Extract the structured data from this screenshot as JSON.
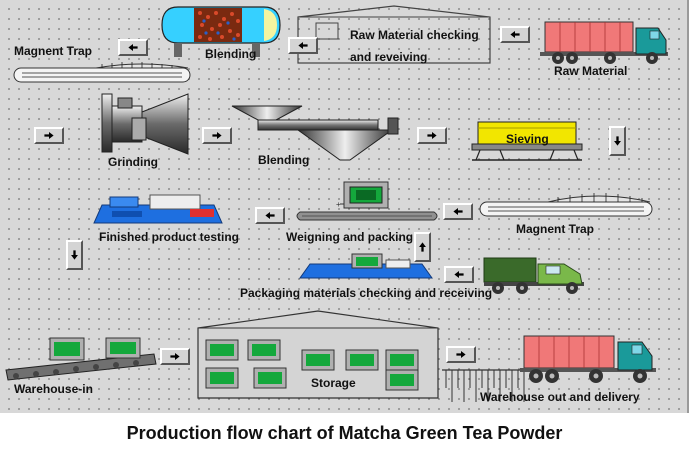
{
  "title": "Production flow chart of Matcha Green Tea Powder",
  "steps": {
    "raw_material": "Raw Material",
    "raw_checking": "Raw Material checking and reveiving",
    "raw_checking_line1": "Raw Material checking",
    "raw_checking_line2": "and reveiving",
    "magnet_trap_top": "Magnent Trap",
    "blending_top": "Blending",
    "grinding": "Grinding",
    "blending_mid": "Blending",
    "sieving": "Sieving",
    "magnet_trap_mid": "Magnent Trap",
    "weighing": "Weigning and packing",
    "finished_testing": "Finished product testing",
    "packaging_checking": "Packaging materials checking and receiving",
    "warehouse_in": "Warehouse-in",
    "storage": "Storage",
    "warehouse_out": "Warehouse out and delivery"
  },
  "colors": {
    "background": "#d8d8d8",
    "truck_cargo": "#f07878",
    "truck_cab": "#1a9a9a",
    "green_truck": "#3a6a2a",
    "sieving_yellow": "#f2e600",
    "testing_blue": "#1e6fe0",
    "screen_green": "#14a83c"
  },
  "icons": [
    "left-arrow-icon",
    "right-arrow-icon",
    "down-arrow-icon",
    "up-arrow-icon"
  ]
}
